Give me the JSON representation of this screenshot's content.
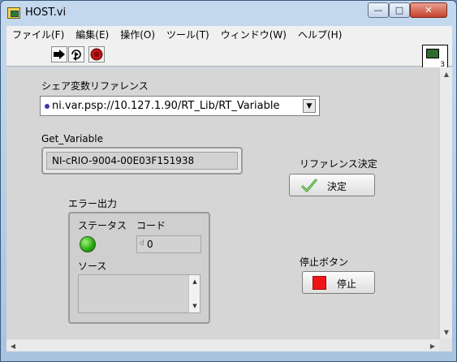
{
  "window": {
    "title": "HOST.vi",
    "minimize_glyph": "—",
    "maximize_glyph": "□",
    "close_glyph": "✕"
  },
  "menu": {
    "items": [
      "ファイル(F)",
      "編集(E)",
      "操作(O)",
      "ツール(T)",
      "ウィンドウ(W)",
      "ヘルプ(H)"
    ]
  },
  "toolbar": {
    "icons": [
      "run-arrow-icon",
      "run-continuously-icon",
      "abort-icon"
    ],
    "vi_icon_number": "3"
  },
  "front_panel": {
    "shared_var_ref": {
      "label": "シェア変数リファレンス",
      "value": "ni.var.psp://10.127.1.90/RT_Lib/RT_Variable",
      "visible_text": "ni.var.psp://10.127.1.90/RT_Lib/RT_Variable"
    },
    "get_variable": {
      "label": "Get_Variable",
      "value": "NI-cRIO-9004-00E03F151938"
    },
    "reference_button": {
      "label": "リファレンス決定",
      "text": "決定",
      "icon": "check-icon"
    },
    "error_out": {
      "label": "エラー出力",
      "status_label": "ステータス",
      "code_label": "コード",
      "code_prefix": "d",
      "code_value": "0",
      "source_label": "ソース",
      "source_value": "",
      "status_color": "#24a80e"
    },
    "stop_button": {
      "label": "停止ボタン",
      "text": "停止",
      "icon": "stop-square-icon",
      "color": "#f21414"
    }
  },
  "scrollbars": {
    "up": "▲",
    "down": "▼",
    "left": "◀",
    "right": "▶"
  }
}
